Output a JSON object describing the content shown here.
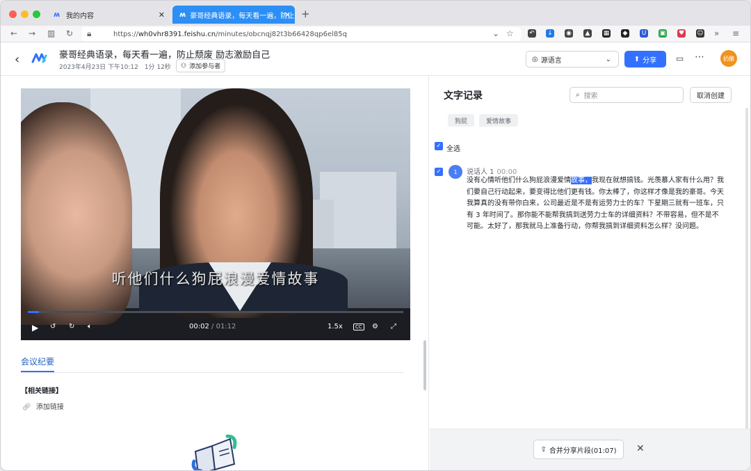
{
  "browser": {
    "tabs": [
      {
        "label": "我的内容"
      },
      {
        "label": "豪哥经典语录，每天看一遍，防止颓废 励志激励自己"
      }
    ],
    "url_prefix": "https://",
    "url_host": "wh0vhr8391.feishu.cn",
    "url_path": "/minutes/obcnqj82t3b66428qp6el85q"
  },
  "header": {
    "title": "豪哥经典语录，每天看一遍，防止颓废 励志激励自己",
    "date": "2023年4月23日 下午10:12",
    "duration": "1分 12秒",
    "add_participant": "添加参与者",
    "language_select": "源语言",
    "share": "分享",
    "user_avatar": "奶酪"
  },
  "video": {
    "subtitle": "听他们什么狗屁浪漫爱情故事",
    "current_time": "00:02",
    "total_time": "01:12",
    "progress": 0.03,
    "speed": "1.5x"
  },
  "left": {
    "tab_label": "会议纪要",
    "related_links_heading": "【相关链接】",
    "add_link": "添加链接"
  },
  "right": {
    "title": "文字记录",
    "search_placeholder": "搜索",
    "cancel_create": "取消创建",
    "tags": [
      "狗屁",
      "爱情故事"
    ],
    "select_all": "全选",
    "speaker": "说话人 1",
    "speaker_badge": "1",
    "speaker_time": "00:00",
    "transcript_before": "没有心情听他们什么狗屁浪漫爱情",
    "transcript_highlight": "故事，",
    "transcript_after": "我现在就想搞钱。光羡慕人家有什么用？我们要自己行动起来，要变得比他们更有钱。你太棒了，你这样才像是我的豪哥。今天我算真的没有带你白来，公司最近是不是有运劳力士的车？下星期三就有一班车，只有 3 年时间了。那你能不能帮我搞到送劳力士车的详细资料？不带容易，但不是不可能。太好了，那我就马上准备行动，你帮我搞到详细资料怎么样？没问题。",
    "merge_button": "合并分享片段(01:07)"
  }
}
